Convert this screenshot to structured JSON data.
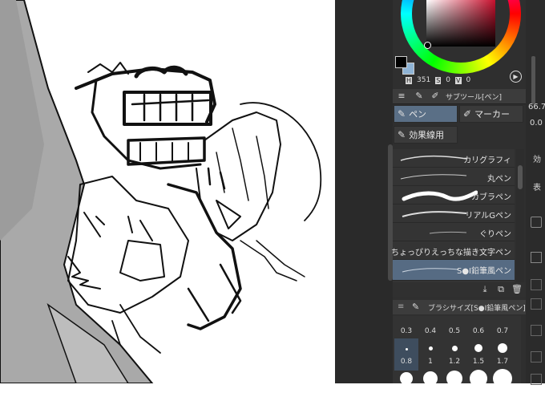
{
  "color_panel": {
    "h_label": "H",
    "h_value": "351",
    "s_label": "S",
    "s_value": "0",
    "v_label": "V",
    "v_value": "0",
    "main_color": "#000000",
    "sub_color": "#8fb4d6"
  },
  "subtool": {
    "title": "サブツール[ペン]",
    "categories": [
      {
        "label": "ペン",
        "selected": true
      },
      {
        "label": "マーカー",
        "selected": false
      },
      {
        "label": "効果線用",
        "selected": false
      }
    ],
    "brushes": [
      {
        "name": "カリグラフィ",
        "selected": false
      },
      {
        "name": "丸ペン",
        "selected": false
      },
      {
        "name": "カブラペン",
        "selected": false
      },
      {
        "name": "リアルGペン",
        "selected": false
      },
      {
        "name": "ぐりペン",
        "selected": false
      },
      {
        "name": "ちょっぴりえっちな描き文字ペン",
        "selected": false
      },
      {
        "name": "S●I鉛筆風ペン",
        "selected": true
      }
    ]
  },
  "brush_size": {
    "title": "ブラシサイズ[S●I鉛筆風ペン]",
    "sizes": [
      "0.3",
      "0.4",
      "0.5",
      "0.6",
      "0.7",
      "0.8",
      "1",
      "1.2",
      "1.5",
      "1.7"
    ],
    "selected": "0.8"
  },
  "right_panel": {
    "value1": "66.7",
    "value2": "0.0",
    "label1": "効",
    "label2": "表"
  }
}
